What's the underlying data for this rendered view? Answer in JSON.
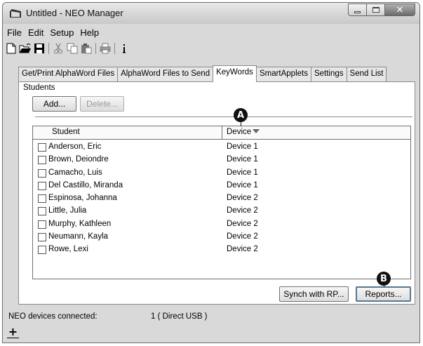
{
  "window": {
    "title": "Untitled - NEO Manager",
    "close_glyph": "✕"
  },
  "menu": [
    "File",
    "Edit",
    "Setup",
    "Help"
  ],
  "toolbar": {
    "icons": [
      "new-icon",
      "open-icon",
      "save-icon",
      "cut-icon",
      "copy-icon",
      "paste-icon",
      "print-icon",
      "info-icon"
    ]
  },
  "tabs": [
    {
      "label": "Get/Print AlphaWord Files",
      "active": false
    },
    {
      "label": "AlphaWord Files to Send",
      "active": false
    },
    {
      "label": "KeyWords",
      "active": true
    },
    {
      "label": "SmartApplets",
      "active": false
    },
    {
      "label": "Settings",
      "active": false
    },
    {
      "label": "Send List",
      "active": false
    }
  ],
  "students": {
    "section_label": "Students",
    "add_label": "Add...",
    "delete_label": "Delete...",
    "columns": {
      "student": "Student",
      "device": "Device"
    },
    "rows": [
      {
        "name": "Anderson, Eric",
        "device": "Device 1",
        "checked": false
      },
      {
        "name": "Brown, Deiondre",
        "device": "Device 1",
        "checked": false
      },
      {
        "name": "Camacho, Luis",
        "device": "Device 1",
        "checked": false
      },
      {
        "name": "Del Castillo, Miranda",
        "device": "Device 1",
        "checked": false
      },
      {
        "name": "Espinosa, Johanna",
        "device": "Device 2",
        "checked": false
      },
      {
        "name": "Little, Julia",
        "device": "Device 2",
        "checked": false
      },
      {
        "name": "Murphy, Kathleen",
        "device": "Device 2",
        "checked": false
      },
      {
        "name": "Neumann, Kayla",
        "device": "Device 2",
        "checked": false
      },
      {
        "name": "Rowe, Lexi",
        "device": "Device 2",
        "checked": false
      }
    ],
    "synch_label": "Synch with RP...",
    "reports_label": "Reports..."
  },
  "callouts": {
    "a": "A",
    "b": "B"
  },
  "status": {
    "label": "NEO devices connected:",
    "value": "1 ( Direct USB )",
    "expand_glyph": "+"
  }
}
